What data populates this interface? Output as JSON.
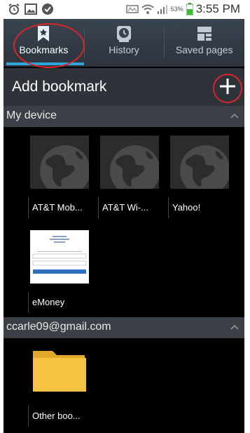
{
  "status_bar": {
    "time": "3:55 PM",
    "battery": "53%",
    "icons": [
      "alarm-icon",
      "gallery-icon",
      "check-shield-icon",
      "notification-icon",
      "wifi-icon",
      "signal-icon",
      "battery-icon"
    ]
  },
  "tabs": [
    {
      "label": "Bookmarks",
      "icon": "bookmark-star-icon",
      "active": true
    },
    {
      "label": "History",
      "icon": "clock-icon",
      "active": false
    },
    {
      "label": "Saved pages",
      "icon": "saved-pages-icon",
      "active": false
    }
  ],
  "add_bookmark": {
    "title": "Add bookmark",
    "icon": "plus-icon"
  },
  "sections": [
    {
      "label": "My device",
      "items": [
        {
          "label": "AT&T Mob...",
          "thumb": "globe"
        },
        {
          "label": "AT&T Wi-...",
          "thumb": "globe"
        },
        {
          "label": "Yahoo!",
          "thumb": "globe"
        },
        {
          "label": "eMoney",
          "thumb": "page"
        }
      ]
    },
    {
      "label": "ccarle09@gmail.com",
      "items": [
        {
          "label": "Other boo...",
          "thumb": "folder"
        }
      ]
    }
  ],
  "colors": {
    "accent": "#2fa6d8",
    "annotation": "#d8252b",
    "folder": "#f5c342"
  }
}
